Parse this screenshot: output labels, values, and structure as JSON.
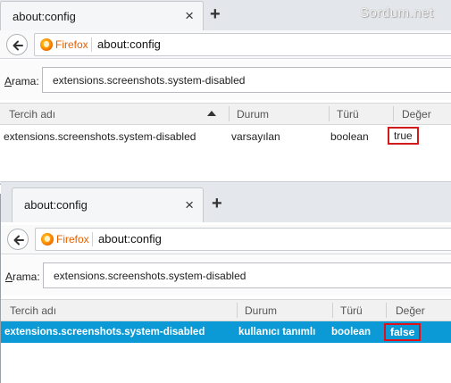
{
  "watermark": "Sordum.net",
  "panels": [
    {
      "tab_title": "about:config",
      "tab_close": "×",
      "new_tab": "+",
      "identity_label": "Firefox",
      "url": "about:config",
      "search_label_accel": "A",
      "search_label_rest": "rama:",
      "search_value": "extensions.screenshots.system-disabled",
      "columns": [
        "Tercih adı",
        "Durum",
        "Türü",
        "Değer"
      ],
      "rows": [
        {
          "name": "extensions.screenshots.system-disabled",
          "status": "varsayılan",
          "type": "boolean",
          "value": "true",
          "selected": false
        }
      ]
    },
    {
      "tab_title": "about:config",
      "tab_close": "×",
      "new_tab": "+",
      "identity_label": "Firefox",
      "url": "about:config",
      "search_label_accel": "A",
      "search_label_rest": "rama:",
      "search_value": "extensions.screenshots.system-disabled",
      "columns": [
        "Tercih adı",
        "Durum",
        "Türü",
        "Değer"
      ],
      "rows": [
        {
          "name": "extensions.screenshots.system-disabled",
          "status": "kullanıcı tanımlı",
          "type": "boolean",
          "value": "false",
          "selected": true
        }
      ]
    }
  ],
  "icons": {
    "back": "back-arrow-icon",
    "identity": "firefox-icon",
    "sort": "sort-ascending-icon"
  },
  "colors": {
    "highlight_box": "#d11a1a",
    "selected_row": "#0c9ad7",
    "firefox_label": "#e66000"
  }
}
